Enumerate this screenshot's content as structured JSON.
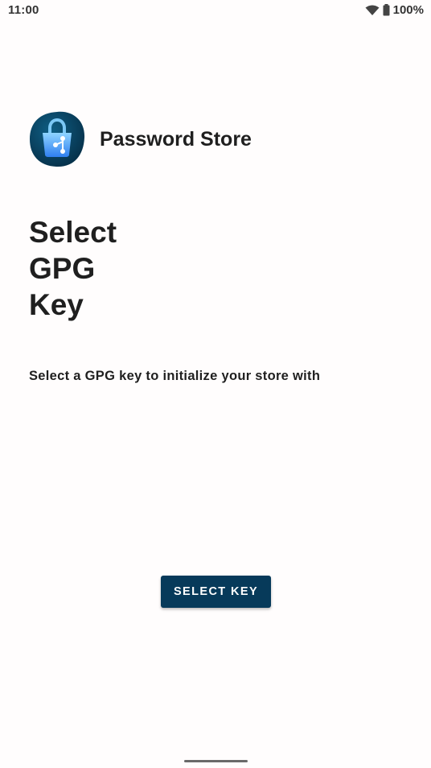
{
  "status_bar": {
    "time": "11:00",
    "battery": "100%",
    "icons": [
      "wifi-icon",
      "battery-icon"
    ]
  },
  "app": {
    "name": "Password Store",
    "logo": "password-store-logo-icon"
  },
  "page": {
    "title": "Select GPG Key",
    "subtitle": "Select a GPG key to initialize your store with"
  },
  "actions": {
    "select_key": "SELECT KEY"
  },
  "colors": {
    "accent": "#073a5a",
    "background": "#fffdfd",
    "text": "#1f1f1f"
  }
}
